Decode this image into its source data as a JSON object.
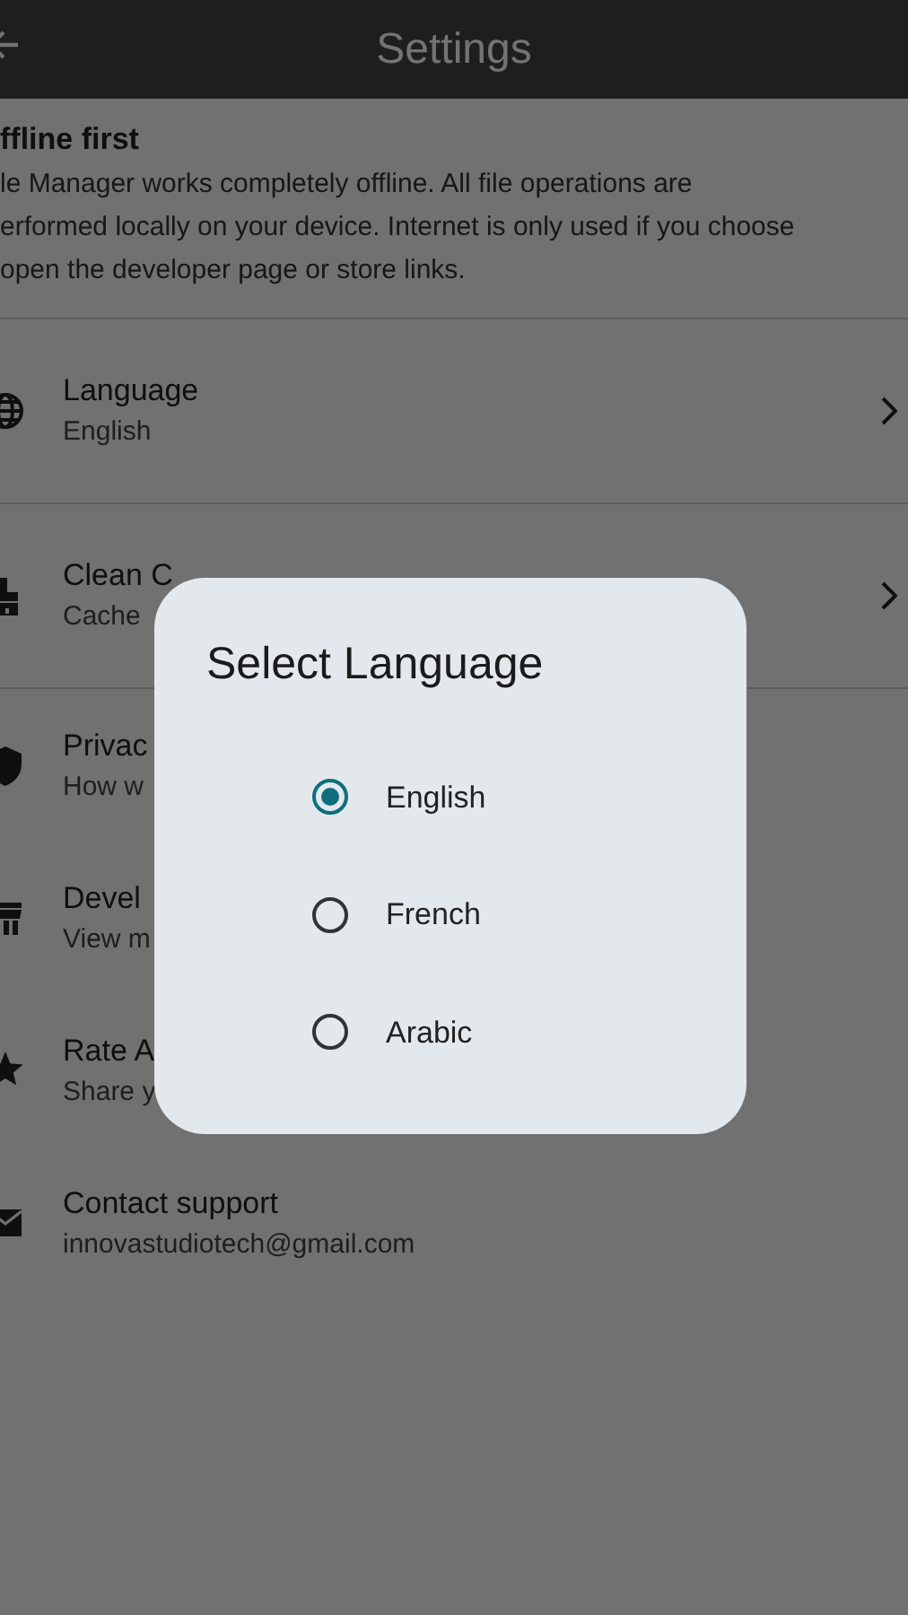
{
  "app_bar": {
    "title": "Settings"
  },
  "notice": {
    "title": "ffline first",
    "lines": [
      "le Manager works completely offline. All file operations are",
      "erformed locally on your device. Internet is only used if you choose",
      "open the developer page or store links."
    ]
  },
  "settings": [
    {
      "kind": "globe",
      "title": "Language",
      "subtitle": "English",
      "chevron": true
    },
    {
      "kind": "brush",
      "title": "Clean C",
      "subtitle": "Cache",
      "chevron": true
    },
    {
      "kind": "shield",
      "title": "Privac",
      "subtitle": "How w",
      "chevron": false
    },
    {
      "kind": "store",
      "title": "Devel",
      "subtitle": "View m",
      "chevron": false
    },
    {
      "kind": "star",
      "title": "Rate A",
      "subtitle": "Share y",
      "chevron": false
    },
    {
      "kind": "mail",
      "title": "Contact support",
      "subtitle": "innovastudiotech@gmail.com",
      "chevron": false
    }
  ],
  "dialog": {
    "title": "Select Language",
    "options": [
      {
        "label": "English",
        "selected": true
      },
      {
        "label": "French",
        "selected": false
      },
      {
        "label": "Arabic",
        "selected": false
      }
    ]
  }
}
